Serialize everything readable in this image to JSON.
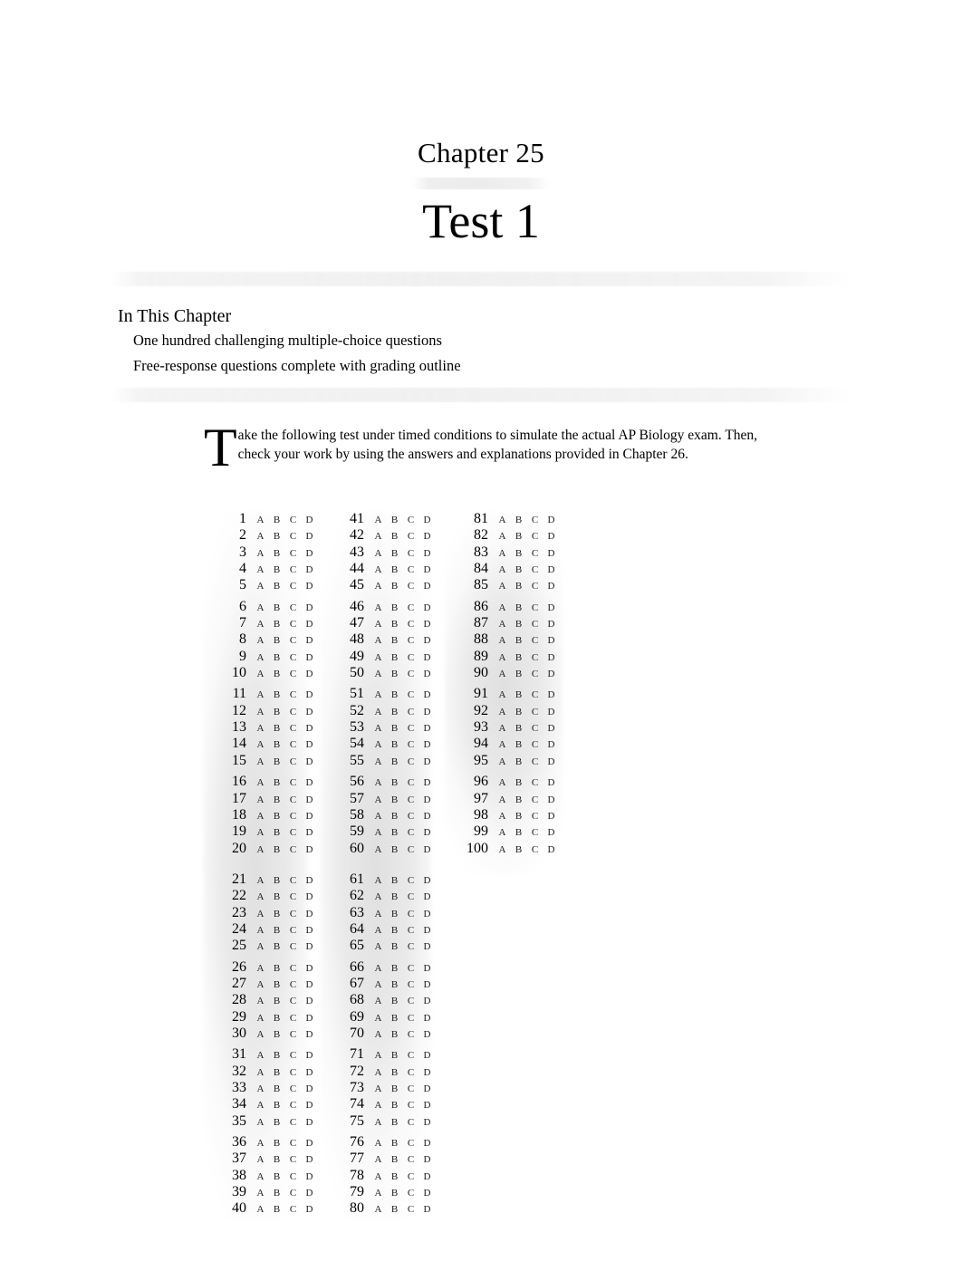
{
  "header": {
    "chapter_number": "Chapter 25",
    "test_title": "Test 1",
    "in_this_chapter_label": "In This Chapter",
    "chapter_items": [
      "One hundred challenging multiple-choice questions",
      "Free-response questions complete with grading outline"
    ]
  },
  "intro": {
    "dropcap": "T",
    "text": "ake the following test under timed conditions to simulate the actual AP Biology exam. Then, check your work by using the answers and explanations provided in Chapter 26."
  },
  "answer_sheet": {
    "choices": [
      "A",
      "B",
      "C",
      "D"
    ],
    "columns": [
      {
        "name": "column-1",
        "start": 1,
        "end": 40,
        "blocks": [
          [
            1,
            2,
            3,
            4,
            5
          ],
          [
            6,
            7,
            8,
            9,
            10
          ],
          [
            11,
            12,
            13,
            14,
            15
          ],
          [
            16,
            17,
            18,
            19,
            20
          ],
          [
            21,
            22,
            23,
            24,
            25
          ],
          [
            26,
            27,
            28,
            29,
            30
          ],
          [
            31,
            32,
            33,
            34,
            35
          ],
          [
            36,
            37,
            38,
            39,
            40
          ]
        ]
      },
      {
        "name": "column-2",
        "start": 41,
        "end": 80,
        "blocks": [
          [
            41,
            42,
            43,
            44,
            45
          ],
          [
            46,
            47,
            48,
            49,
            50
          ],
          [
            51,
            52,
            53,
            54,
            55
          ],
          [
            56,
            57,
            58,
            59,
            60
          ],
          [
            61,
            62,
            63,
            64,
            65
          ],
          [
            66,
            67,
            68,
            69,
            70
          ],
          [
            71,
            72,
            73,
            74,
            75
          ],
          [
            76,
            77,
            78,
            79,
            80
          ]
        ]
      },
      {
        "name": "column-3",
        "start": 81,
        "end": 100,
        "blocks": [
          [
            81,
            82,
            83,
            84,
            85
          ],
          [
            86,
            87,
            88,
            89,
            90
          ],
          [
            91,
            92,
            93,
            94,
            95
          ],
          [
            96,
            97,
            98,
            99,
            100
          ]
        ]
      }
    ]
  },
  "colors": {
    "page_background": "#ffffff",
    "text": "#000000",
    "rule_gray": "#f0f0f0",
    "column_shade_gray": "#e6e6e6"
  }
}
